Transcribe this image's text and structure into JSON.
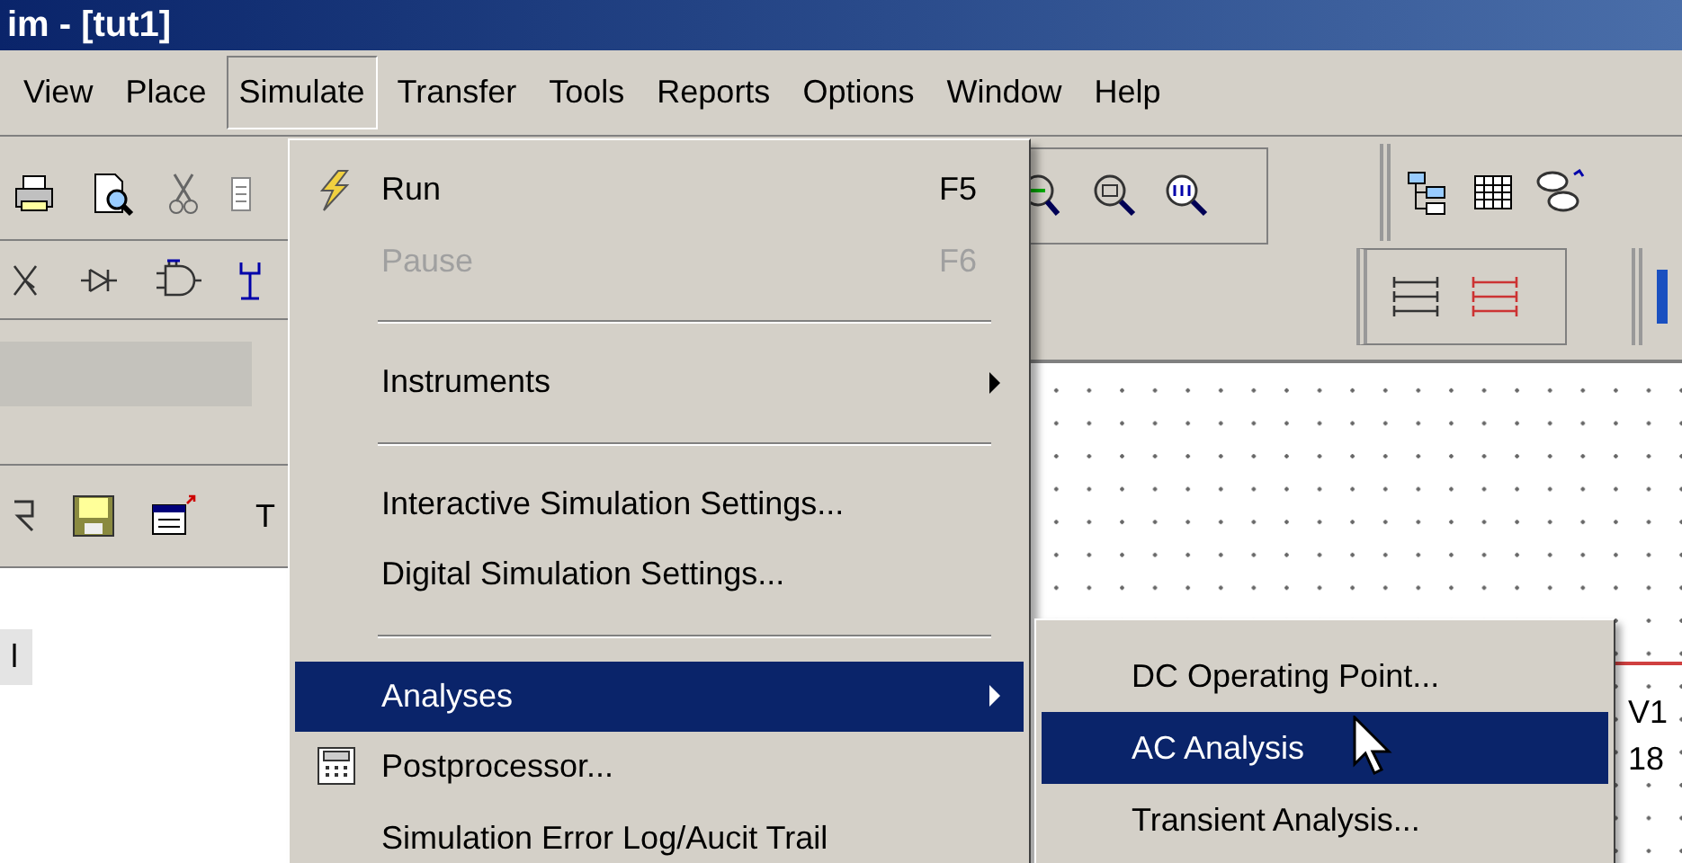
{
  "window": {
    "title": "im - [tut1]"
  },
  "menu_bar": [
    {
      "label": "View",
      "selected": false
    },
    {
      "label": "Place",
      "selected": false
    },
    {
      "label": "Simulate",
      "selected": true
    },
    {
      "label": "Transfer",
      "selected": false
    },
    {
      "label": "Tools",
      "selected": false
    },
    {
      "label": "Reports",
      "selected": false
    },
    {
      "label": "Options",
      "selected": false
    },
    {
      "label": "Window",
      "selected": false
    },
    {
      "label": "Help",
      "selected": false
    }
  ],
  "toolbar_text": "T",
  "panel_item": {
    "label": "l",
    "selected": true
  },
  "simulate_menu": [
    {
      "kind": "action",
      "label": "Run",
      "shortcut": "F5",
      "disabled": false,
      "selected": false,
      "submenu": false
    },
    {
      "kind": "item",
      "label": "Pause",
      "shortcut": "F6",
      "disabled": true,
      "selected": false,
      "submenu": false
    },
    {
      "kind": "separator"
    },
    {
      "kind": "item",
      "label": "Instruments",
      "disabled": false,
      "selected": false,
      "submenu": true
    },
    {
      "kind": "separator"
    },
    {
      "kind": "item",
      "label": "Interactive Simulation Settings...",
      "disabled": false,
      "selected": false,
      "submenu": false
    },
    {
      "kind": "item",
      "label": "Digital Simulation Settings...",
      "disabled": false,
      "selected": false,
      "submenu": false
    },
    {
      "kind": "separator"
    },
    {
      "kind": "item",
      "label": "Analyses",
      "disabled": false,
      "selected": true,
      "submenu": true
    },
    {
      "kind": "tool",
      "label": "Postprocessor...",
      "disabled": false,
      "selected": false,
      "submenu": false
    },
    {
      "kind": "item",
      "label": "Simulation Error Log/Aucit Trail",
      "disabled": false,
      "selected": false,
      "submenu": false
    }
  ],
  "analyses_submenu": [
    {
      "label": "DC Operating Point...",
      "selected": false
    },
    {
      "label": "AC Analysis",
      "selected": true
    },
    {
      "label": "Transient Analysis...",
      "selected": false
    }
  ],
  "canvas_labels": [
    "V1",
    "18"
  ]
}
